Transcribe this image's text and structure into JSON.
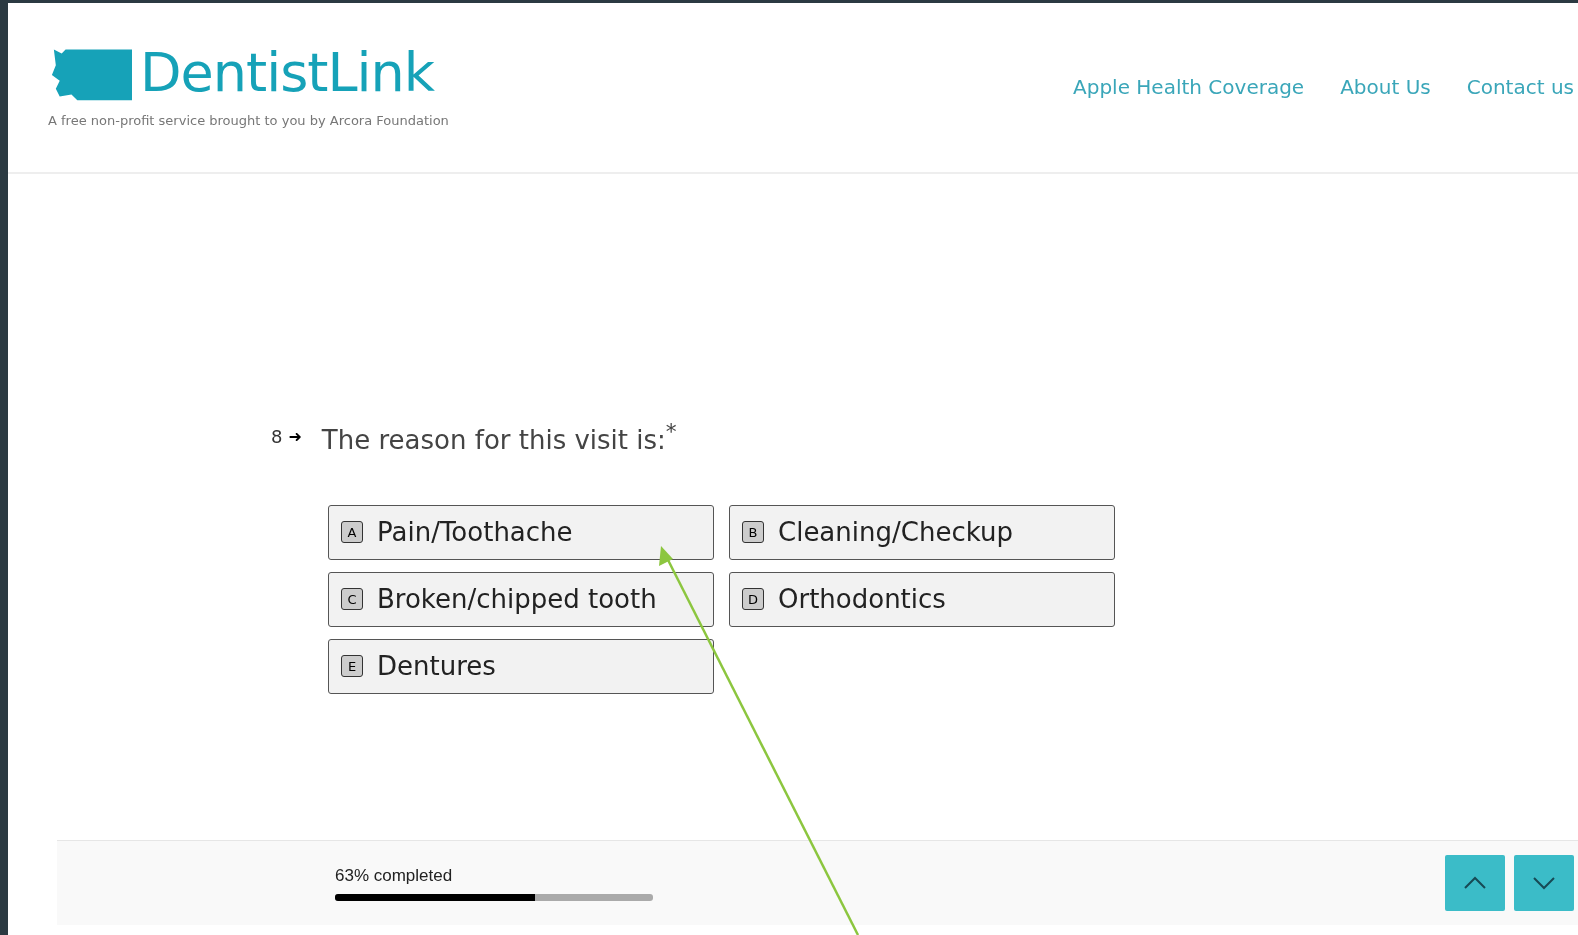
{
  "header": {
    "logo": "DentistLink",
    "tagline": "A free non-profit service brought to you by Arcora Foundation",
    "nav": [
      "Apple Health Coverage",
      "About Us",
      "Contact us"
    ]
  },
  "question": {
    "number": "8",
    "arrow": "➜",
    "text": "The reason for this visit is:$^{*}$",
    "options": [
      {
        "key": "A",
        "label": "Pain/Toothache",
        "selected": false
      },
      {
        "key": "B",
        "label": "Cleaning/Checkup",
        "selected": false
      },
      {
        "key": "C",
        "label": "Broken/chipped tooth",
        "selected": false
      },
      {
        "key": "D",
        "label": "Orthodontics",
        "selected": false
      },
      {
        "key": "E",
        "label": "Dentures",
        "selected": false
      }
    ]
  },
  "progress": {
    "label": "63% completed",
    "level": 0.63
  },
  "annotation": {
    "kind": "arrow"
  }
}
